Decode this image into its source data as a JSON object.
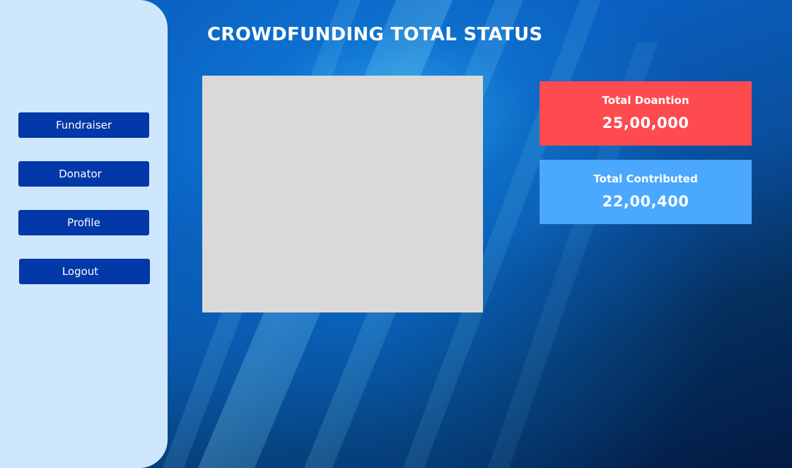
{
  "sidebar": {
    "items": [
      {
        "label": "Fundraiser"
      },
      {
        "label": "Donator"
      },
      {
        "label": "Profile"
      },
      {
        "label": "Logout"
      }
    ]
  },
  "header": {
    "title": "CROWDFUNDING TOTAL STATUS"
  },
  "stats": {
    "total_donation": {
      "label": "Total Doantion",
      "value": "25,00,000",
      "color": "#fe4b4f"
    },
    "total_contributed": {
      "label": "Total Contributed",
      "value": "22,00,400",
      "color": "#4aa8fd"
    }
  },
  "colors": {
    "sidebar_bg": "#cfe7fd",
    "nav_button": "#0338a8",
    "placeholder": "#d9d9d9"
  }
}
